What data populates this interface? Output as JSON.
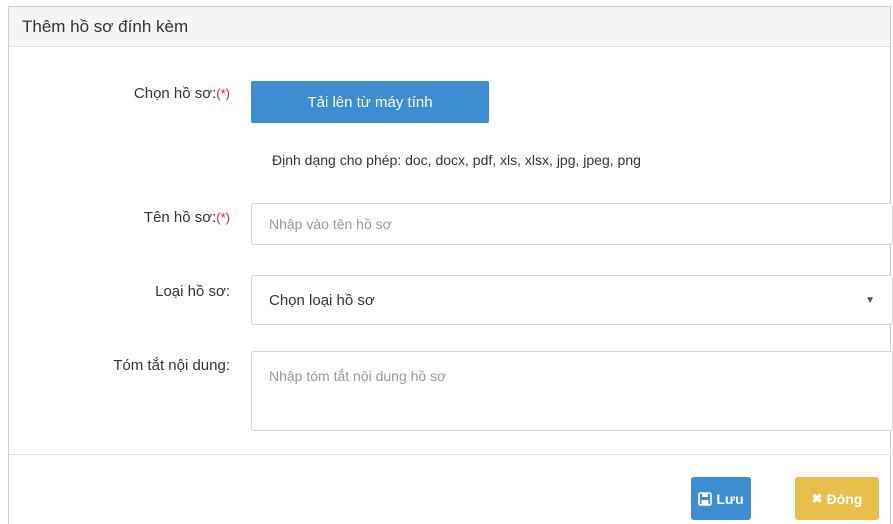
{
  "modal": {
    "title": "Thêm hồ sơ đính kèm"
  },
  "form": {
    "file": {
      "label": "Chọn hồ sơ:",
      "required_mark": "(*)",
      "upload_label": "Tải lên từ máy tính",
      "hint": "Định dạng cho phép: doc, docx, pdf, xls, xlsx, jpg, jpeg, png"
    },
    "name": {
      "label": "Tên hồ sơ:",
      "required_mark": "(*)",
      "value": "",
      "placeholder": "Nhập vào tên hồ sơ"
    },
    "type": {
      "label": "Loại hồ sơ:",
      "selected": "Chọn loại hồ sơ"
    },
    "summary": {
      "label": "Tóm tắt nội dung:",
      "value": "",
      "placeholder": "Nhập tóm tắt nội dung hồ sơ"
    }
  },
  "footer": {
    "save_label": "Lưu",
    "close_label": "Đóng"
  },
  "icons": {
    "save": "floppy-disk-icon",
    "close": "x-icon",
    "select": "caret-down-icon"
  },
  "colors": {
    "primary": "#3c8dd2",
    "warning": "#e9bf4c",
    "required": "#e02020"
  }
}
